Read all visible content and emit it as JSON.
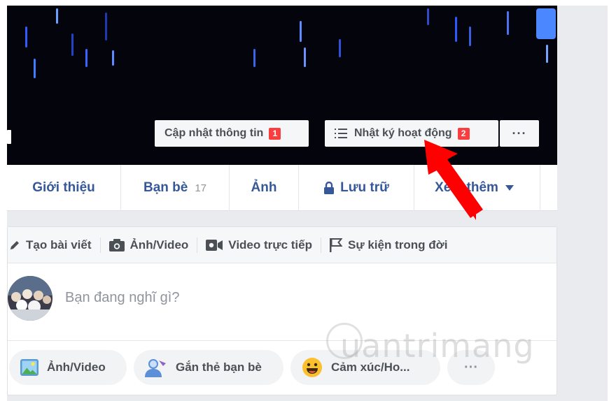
{
  "cover": {
    "update_info_label": "Cập nhật thông tin",
    "update_info_badge": "1",
    "activity_log_label": "Nhật ký hoạt động",
    "activity_log_badge": "2",
    "more_label": "···"
  },
  "tabs": [
    {
      "label": "Giới thiệu"
    },
    {
      "label": "Bạn bè",
      "count": "17"
    },
    {
      "label": "Ảnh"
    },
    {
      "label": "Lưu trữ"
    },
    {
      "label": "Xem thêm"
    }
  ],
  "composer": {
    "actions": [
      "Tạo bài viết",
      "Ảnh/Video",
      "Video trực tiếp",
      "Sự kiện trong đời"
    ],
    "placeholder": "Bạn đang nghĩ gì?",
    "pills": [
      "Ảnh/Video",
      "Gắn thẻ bạn bè",
      "Cảm xúc/Ho...",
      "···"
    ]
  },
  "watermark": "uantrimang",
  "colors": {
    "link_blue": "#365899",
    "badge_red": "#fa3e3e",
    "arrow_red": "#ff0000",
    "page_bg": "#e9ebee"
  }
}
